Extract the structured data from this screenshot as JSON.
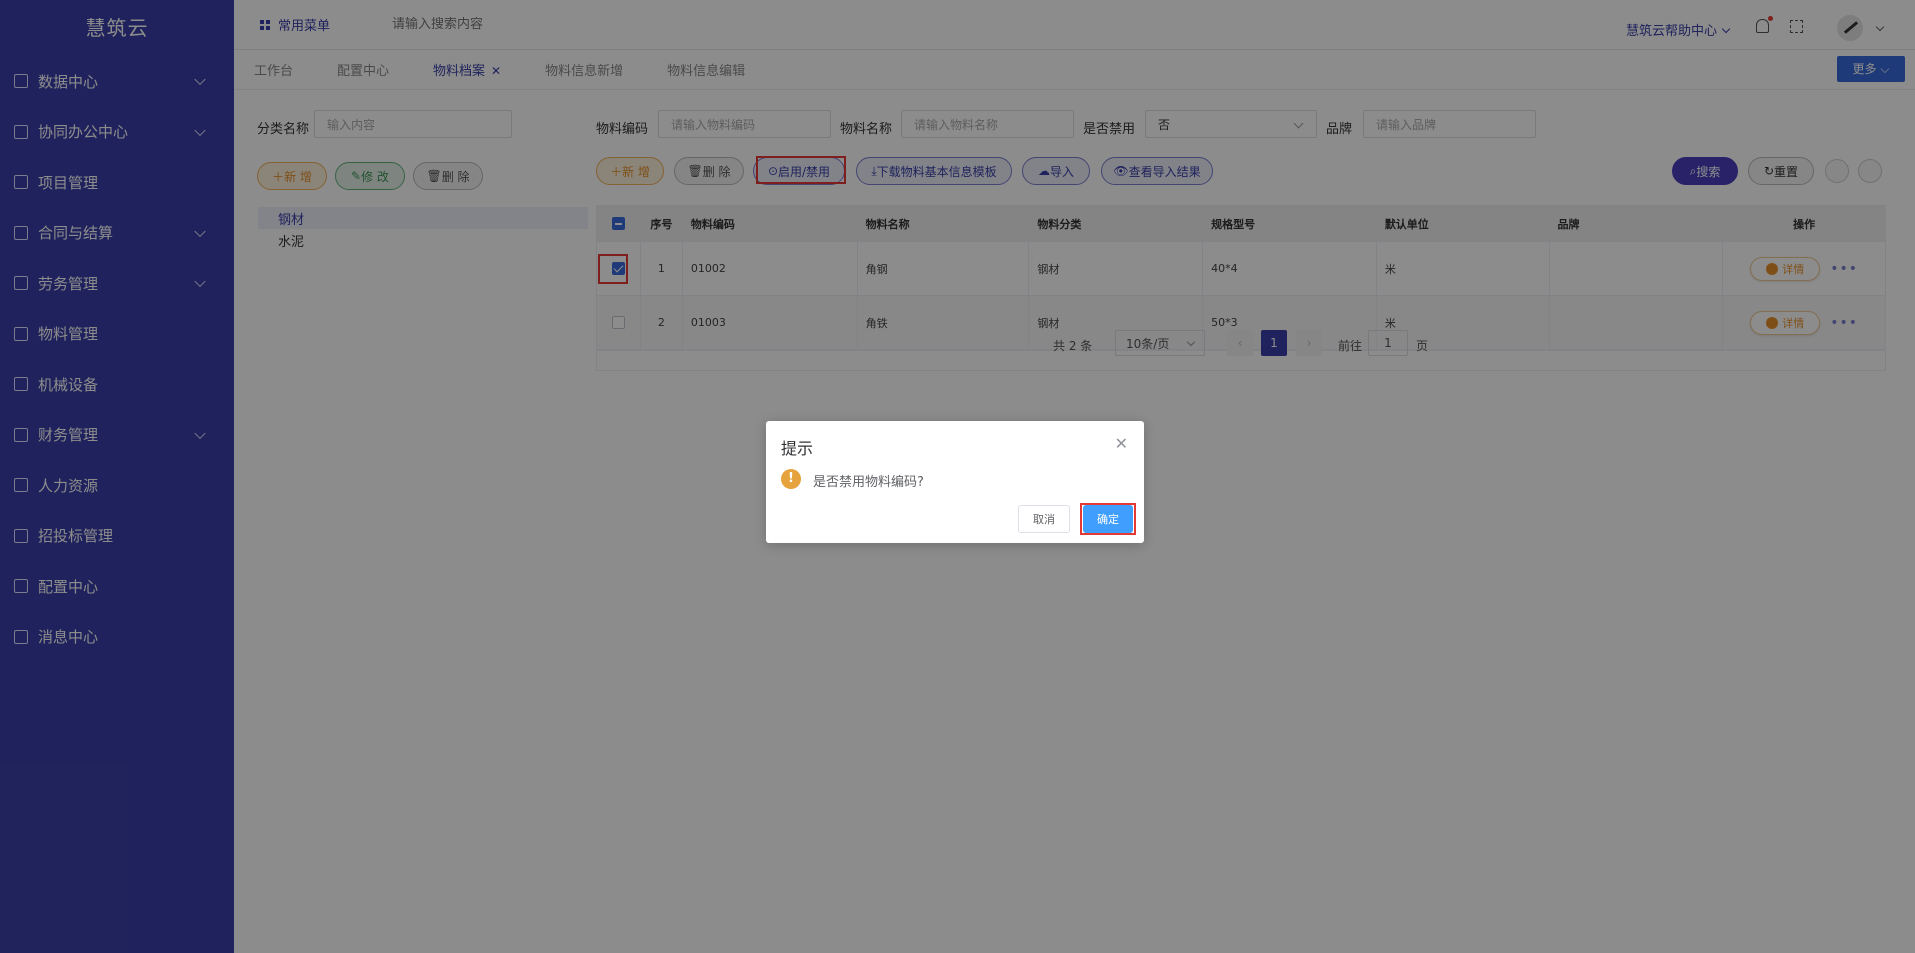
{
  "app": {
    "name": "慧筑云"
  },
  "sidebar": {
    "items": [
      {
        "label": "数据中心",
        "expandable": true
      },
      {
        "label": "协同办公中心",
        "expandable": true
      },
      {
        "label": "项目管理",
        "expandable": false
      },
      {
        "label": "合同与结算",
        "expandable": true
      },
      {
        "label": "劳务管理",
        "expandable": true
      },
      {
        "label": "物料管理",
        "expandable": false
      },
      {
        "label": "机械设备",
        "expandable": false
      },
      {
        "label": "财务管理",
        "expandable": true
      },
      {
        "label": "人力资源",
        "expandable": false
      },
      {
        "label": "招投标管理",
        "expandable": false
      },
      {
        "label": "配置中心",
        "expandable": false
      },
      {
        "label": "消息中心",
        "expandable": false
      }
    ]
  },
  "topbar": {
    "common_menu": "常用菜单",
    "search_placeholder": "请输入搜索内容",
    "help": "慧筑云帮助中心"
  },
  "tabs": [
    {
      "label": "工作台",
      "active": false
    },
    {
      "label": "配置中心",
      "active": false
    },
    {
      "label": "物料档案",
      "active": true,
      "closable": true
    },
    {
      "label": "物料信息新增",
      "active": false
    },
    {
      "label": "物料信息编辑",
      "active": false
    }
  ],
  "more_label": "更多",
  "left_panel": {
    "label": "分类名称",
    "placeholder": "输入内容",
    "add": "新 增",
    "edit": "修 改",
    "delete": "删 除",
    "tree": [
      "钢材",
      "水泥"
    ]
  },
  "filters": {
    "code_label": "物料编码",
    "code_placeholder": "请输入物料编码",
    "name_label": "物料名称",
    "name_placeholder": "请输入物料名称",
    "disabled_label": "是否禁用",
    "disabled_value": "否",
    "brand_label": "品牌",
    "brand_placeholder": "请输入品牌"
  },
  "toolbar": {
    "add": "新 增",
    "delete": "删 除",
    "enable_disable": "启用/禁用",
    "download": "下载物料基本信息模板",
    "import": "导入",
    "view_result": "查看导入结果",
    "search": "搜索",
    "reset": "重置"
  },
  "table": {
    "headers": [
      "序号",
      "物料编码",
      "物料名称",
      "物料分类",
      "规格型号",
      "默认单位",
      "品牌",
      "操作"
    ],
    "rows": [
      {
        "idx": "1",
        "code": "01002",
        "name": "角钢",
        "category": "钢材",
        "spec": "40*4",
        "unit": "米",
        "brand": "",
        "checked": true
      },
      {
        "idx": "2",
        "code": "01003",
        "name": "角铁",
        "category": "钢材",
        "spec": "50*3",
        "unit": "米",
        "brand": "",
        "checked": false
      }
    ],
    "detail_label": "详情"
  },
  "pagination": {
    "total": "共 2 条",
    "page_size": "10条/页",
    "current": "1",
    "goto_label": "前往",
    "goto_value": "1",
    "page_suffix": "页"
  },
  "dialog": {
    "title": "提示",
    "message": "是否禁用物料编码?",
    "cancel": "取消",
    "confirm": "确定"
  },
  "colors": {
    "sidebar": "#3a3fa8",
    "primary": "#3a3fa8",
    "confirm": "#409eff",
    "highlight": "#e53935"
  }
}
